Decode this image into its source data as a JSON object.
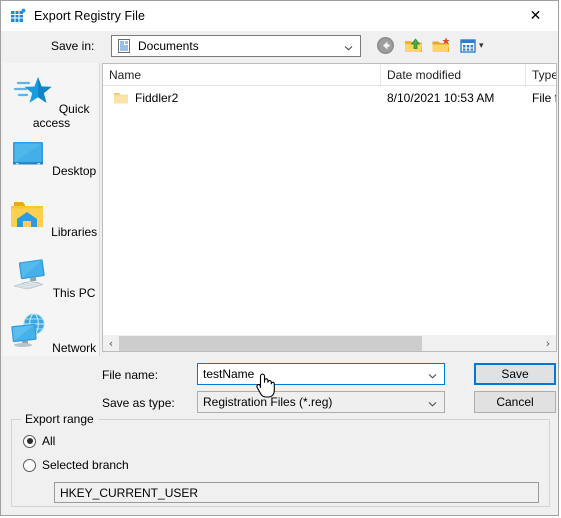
{
  "window": {
    "title": "Export Registry File",
    "icon": "registry-grid-icon",
    "close_label": "✕"
  },
  "savein": {
    "label": "Save in:",
    "value": "Documents",
    "icon": "documents-icon",
    "dropdown_icon": "chevron-down-icon"
  },
  "toolbar": {
    "buttons": [
      {
        "name": "back-button",
        "icon": "back-arrow-icon",
        "title": "Back"
      },
      {
        "name": "up-one-level-button",
        "icon": "up-folder-icon",
        "title": "Up One Level"
      },
      {
        "name": "new-folder-button",
        "icon": "new-folder-icon",
        "title": "Create New Folder"
      },
      {
        "name": "views-button",
        "icon": "views-grid-icon",
        "title": "Views"
      }
    ],
    "views_arrow": "▾"
  },
  "places": {
    "items": [
      {
        "label": "Quick access",
        "icon": "quick-access-star-icon"
      },
      {
        "label": "Desktop",
        "icon": "desktop-monitor-icon"
      },
      {
        "label": "Libraries",
        "icon": "libraries-folder-icon"
      },
      {
        "label": "This PC",
        "icon": "this-pc-computer-icon"
      },
      {
        "label": "Network",
        "icon": "network-globe-icon"
      }
    ]
  },
  "filelist": {
    "columns": [
      {
        "label": "Name",
        "sort": "˄"
      },
      {
        "label": "Date modified",
        "sort": ""
      },
      {
        "label": "Type",
        "sort": ""
      }
    ],
    "rows": [
      {
        "name": "Fiddler2",
        "date_modified": "8/10/2021 10:53 AM",
        "type": "File fo",
        "icon": "folder-icon"
      }
    ],
    "scrollbar": {
      "left_arrow": "‹",
      "right_arrow": "›"
    }
  },
  "form": {
    "filename_label": "File name:",
    "filename_value": "testName",
    "filename_placeholder": "",
    "filetype_label": "Save as type:",
    "filetype_value": "Registration Files (*.reg)",
    "save_label": "Save",
    "cancel_label": "Cancel"
  },
  "export_range": {
    "legend": "Export range",
    "all_label": "All",
    "all_selected": true,
    "branch_label": "Selected branch",
    "branch_selected": false,
    "branch_value": "HKEY_CURRENT_USER"
  },
  "colors": {
    "accent": "#0078d7",
    "window_bg": "#f0f0f0",
    "field_bg": "#ffffff",
    "folder_yellow": "#fbd46a"
  },
  "cursor": {
    "icon": "hand-pointer-cursor"
  }
}
